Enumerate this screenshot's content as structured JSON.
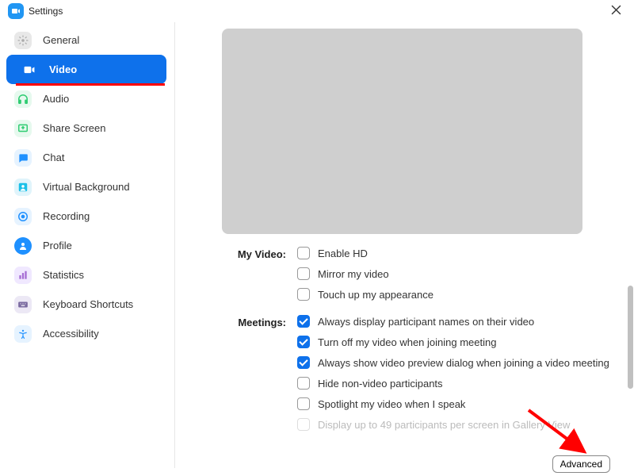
{
  "header": {
    "title": "Settings"
  },
  "sidebar": {
    "items": [
      {
        "label": "General"
      },
      {
        "label": "Video"
      },
      {
        "label": "Audio"
      },
      {
        "label": "Share Screen"
      },
      {
        "label": "Chat"
      },
      {
        "label": "Virtual Background"
      },
      {
        "label": "Recording"
      },
      {
        "label": "Profile"
      },
      {
        "label": "Statistics"
      },
      {
        "label": "Keyboard Shortcuts"
      },
      {
        "label": "Accessibility"
      }
    ]
  },
  "sections": {
    "myVideo": {
      "title": "My Video:",
      "opts": [
        "Enable HD",
        "Mirror my video",
        "Touch up my appearance"
      ]
    },
    "meetings": {
      "title": "Meetings:",
      "opts": [
        "Always display participant names on their video",
        "Turn off my video when joining meeting",
        "Always show video preview dialog when joining a video meeting",
        "Hide non-video participants",
        "Spotlight my video when I speak",
        "Display up to 49 participants per screen in Gallery View"
      ]
    }
  },
  "buttons": {
    "advanced": "Advanced"
  }
}
